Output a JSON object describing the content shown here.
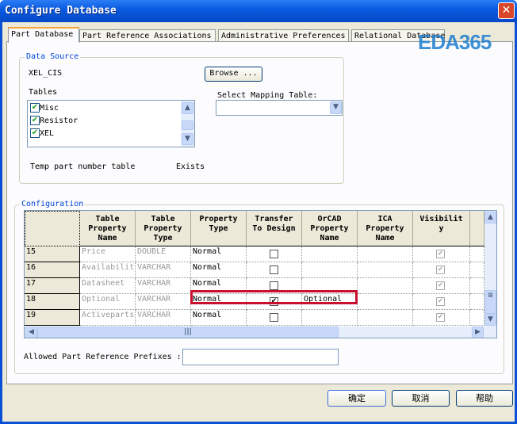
{
  "window": {
    "title": "Configure Database",
    "watermark": "EDA365"
  },
  "tabs": [
    {
      "label": "Part Database",
      "active": true
    },
    {
      "label": "Part Reference Associations"
    },
    {
      "label": "Administrative Preferences"
    },
    {
      "label": "Relational Database"
    }
  ],
  "data_source": {
    "legend": "Data Source",
    "name": "XEL_CIS",
    "browse_label": "Browse ...",
    "tables_label": "Tables",
    "tables": [
      {
        "label": "Misc",
        "checked": true
      },
      {
        "label": "Resistor",
        "checked": true
      },
      {
        "label": "XEL",
        "checked": true
      }
    ],
    "mapping_label": "Select Mapping Table:",
    "mapping_value": "",
    "temp_label": "Temp part number table",
    "temp_status": "Exists"
  },
  "configuration": {
    "legend": "Configuration",
    "columns": [
      "Table\nProperty\nName",
      "Table\nProperty\nType",
      "Property\nType",
      "Transfer\nTo Design",
      "OrCAD\nProperty\nName",
      "ICA\nProperty\nName",
      "Visibilit\ny"
    ],
    "rows": [
      {
        "num": "15",
        "name": "Price",
        "type": "DOUBLE",
        "ptype": "Normal",
        "transfer": false,
        "orcad": "",
        "ica": "",
        "visible": true
      },
      {
        "num": "16",
        "name": "Availability",
        "type": "VARCHAR",
        "ptype": "Normal",
        "transfer": false,
        "orcad": "",
        "ica": "",
        "visible": true
      },
      {
        "num": "17",
        "name": "Datasheet",
        "type": "VARCHAR",
        "ptype": "Normal",
        "transfer": false,
        "orcad": "",
        "ica": "",
        "visible": true
      },
      {
        "num": "18",
        "name": "Optional",
        "type": "VARCHAR",
        "ptype": "Normal",
        "transfer": true,
        "orcad": "Optional",
        "ica": "",
        "visible": true
      },
      {
        "num": "19",
        "name": "Activeparts ID",
        "type": "VARCHAR",
        "ptype": "Normal",
        "transfer": false,
        "orcad": "",
        "ica": "",
        "visible": true
      }
    ],
    "prefix_label": "Allowed Part Reference Prefixes :",
    "prefix_value": "",
    "highlight_color": "#c8102e"
  },
  "buttons": {
    "ok": "确定",
    "cancel": "取消",
    "help": "帮助"
  }
}
